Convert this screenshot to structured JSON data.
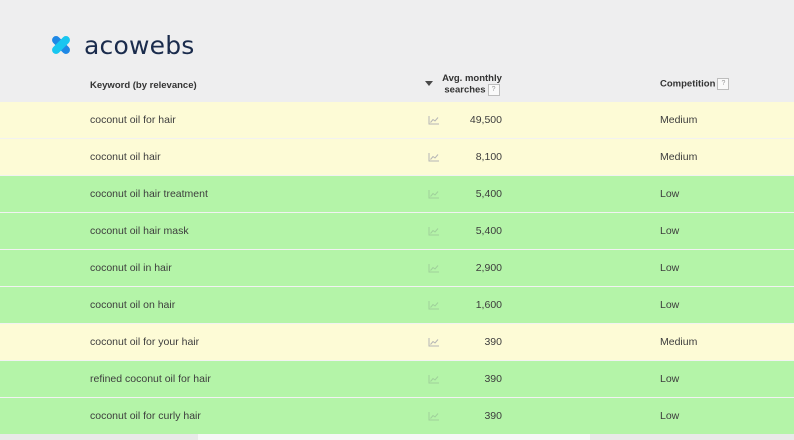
{
  "brand": {
    "name": "acowebs"
  },
  "table": {
    "headers": {
      "keyword": "Keyword (by relevance)",
      "searches_line1": "Avg. monthly",
      "searches_line2": "searches",
      "competition": "Competition",
      "help": "?"
    },
    "rows": [
      {
        "keyword": "coconut oil for hair",
        "searches": "49,500",
        "competition": "Medium"
      },
      {
        "keyword": "coconut oil hair",
        "searches": "8,100",
        "competition": "Medium"
      },
      {
        "keyword": "coconut oil hair treatment",
        "searches": "5,400",
        "competition": "Low"
      },
      {
        "keyword": "coconut oil hair mask",
        "searches": "5,400",
        "competition": "Low"
      },
      {
        "keyword": "coconut oil in hair",
        "searches": "2,900",
        "competition": "Low"
      },
      {
        "keyword": "coconut oil on hair",
        "searches": "1,600",
        "competition": "Low"
      },
      {
        "keyword": "coconut oil for your hair",
        "searches": "390",
        "competition": "Medium"
      },
      {
        "keyword": "refined coconut oil for hair",
        "searches": "390",
        "competition": "Low"
      },
      {
        "keyword": "coconut oil for curly hair",
        "searches": "390",
        "competition": "Low"
      }
    ]
  },
  "colors": {
    "medium_row": "#fdfbd6",
    "low_row": "#b4f4a8",
    "brand_blue": "#1e88e5",
    "brand_cyan": "#18c6f0",
    "brand_text": "#1a2b4c"
  },
  "icons": {
    "trend": "trend-chart-icon",
    "sort": "sort-down-icon",
    "help": "help-icon"
  }
}
